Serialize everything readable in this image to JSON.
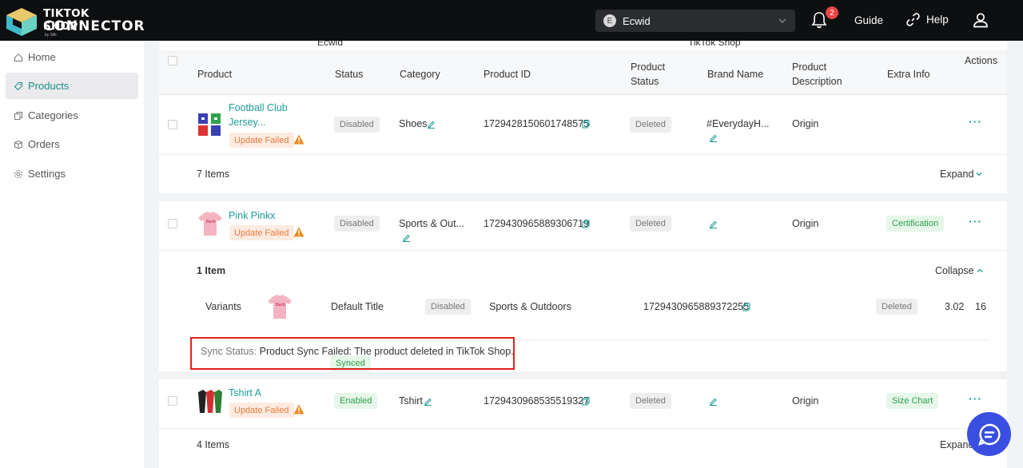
{
  "app": {
    "logo_line1": "TIKTOK SHOP",
    "logo_line2": "CONNECTOR",
    "logo_by": "by Silk"
  },
  "topbar": {
    "store_initial": "E",
    "store_name": "Ecwid",
    "notifications_count": "2",
    "guide_label": "Guide",
    "help_label": "Help"
  },
  "sidebar": {
    "items": [
      {
        "label": "Home",
        "icon": "home-icon"
      },
      {
        "label": "Products",
        "icon": "tag-icon",
        "active": true
      },
      {
        "label": "Categories",
        "icon": "copy-icon"
      },
      {
        "label": "Orders",
        "icon": "box-icon"
      },
      {
        "label": "Settings",
        "icon": "gear-icon"
      }
    ]
  },
  "table": {
    "group_left": "Ecwid",
    "group_right": "TikTok Shop",
    "headers": {
      "product": "Product",
      "status": "Status",
      "category": "Category",
      "product_id": "Product ID",
      "product_status_1": "Product",
      "product_status_2": "Status",
      "brand": "Brand Name",
      "desc_1": "Product",
      "desc_2": "Description",
      "extra": "Extra Info",
      "actions": "Actions"
    },
    "rows": [
      {
        "name_line1": "Football Club",
        "name_line2": "Jersey...",
        "sync_tag": "Update Failed",
        "status": "Disabled",
        "category": "Shoes",
        "product_id": "1729428150601748575",
        "tt_status": "Deleted",
        "brand": "#EverydayH...",
        "description": "Origin",
        "extra": "",
        "items_count": "7 Items",
        "toggle": "Expand"
      },
      {
        "name_line1": "Pink Pinkx",
        "sync_tag": "Update Failed",
        "status": "Disabled",
        "category": "Sports & Out...",
        "product_id": "1729430965889306719",
        "tt_status": "Deleted",
        "brand": "",
        "description": "Origin",
        "extra": "Certification",
        "items_count": "1 Item",
        "toggle": "Collapse",
        "variant": {
          "label": "Variants",
          "title": "Default Title",
          "sync": "Synced",
          "status": "Disabled",
          "category": "Sports & Outdoors",
          "product_id": "1729430965889372255",
          "tt_status": "Deleted",
          "price": "3.02",
          "qty": "16"
        },
        "sync_status_label": "Sync Status:",
        "sync_status_text": "Product Sync Failed: The product deleted in TikTok Shop."
      },
      {
        "name_line1": "Tshirt A",
        "sync_tag": "Update Failed",
        "status": "Enabled",
        "category": "Tshirt",
        "product_id": "1729430968535519327",
        "tt_status": "Deleted",
        "brand": "",
        "description": "Origin",
        "extra": "Size Chart",
        "items_count": "4 Items",
        "toggle": "Expand"
      }
    ]
  },
  "colors": {
    "accent": "#1a9e96",
    "topbar": "#0e0f11",
    "alert": "#e02020",
    "fab": "#3a4fe0"
  }
}
